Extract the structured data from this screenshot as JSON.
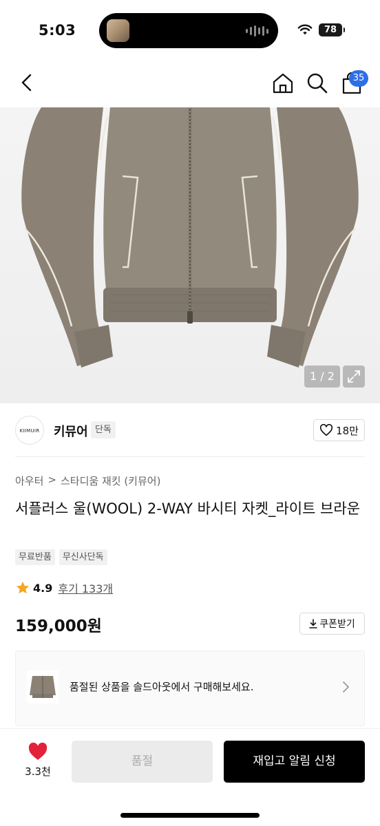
{
  "status_bar": {
    "time": "5:03",
    "battery": "78"
  },
  "header": {
    "cart_count": "35",
    "icons": [
      "back-icon",
      "home-icon",
      "search-icon",
      "cart-icon"
    ]
  },
  "gallery": {
    "counter": "1 / 2"
  },
  "brand": {
    "logo_text": "KIIMUIR",
    "name": "키뮤어",
    "tag": "단독",
    "likes": "18만"
  },
  "product": {
    "breadcrumb": [
      "아우터",
      "스타디움 재킷 (키뮤어)"
    ],
    "breadcrumb_sep": ">",
    "title": "서플러스 울(WOOL) 2-WAY 바시티 자켓_라이트 브라운",
    "tags": [
      "무료반품",
      "무신사단독"
    ],
    "rating": "4.9",
    "reviews": "후기 133개",
    "price": "159,000원",
    "coupon_label": "쿠폰받기"
  },
  "soldout_banner": {
    "text": "품절된 상품을 솔드아웃에서 구매해보세요."
  },
  "bottom_bar": {
    "wish_count": "3.3천",
    "soldout_label": "품절",
    "restock_label": "재입고 알림 신청"
  },
  "colors": {
    "accent_blue": "#2f6ee9",
    "heart_red": "#e4213a",
    "star_orange": "#f5a623",
    "jacket_taupe": "#8b8275"
  }
}
